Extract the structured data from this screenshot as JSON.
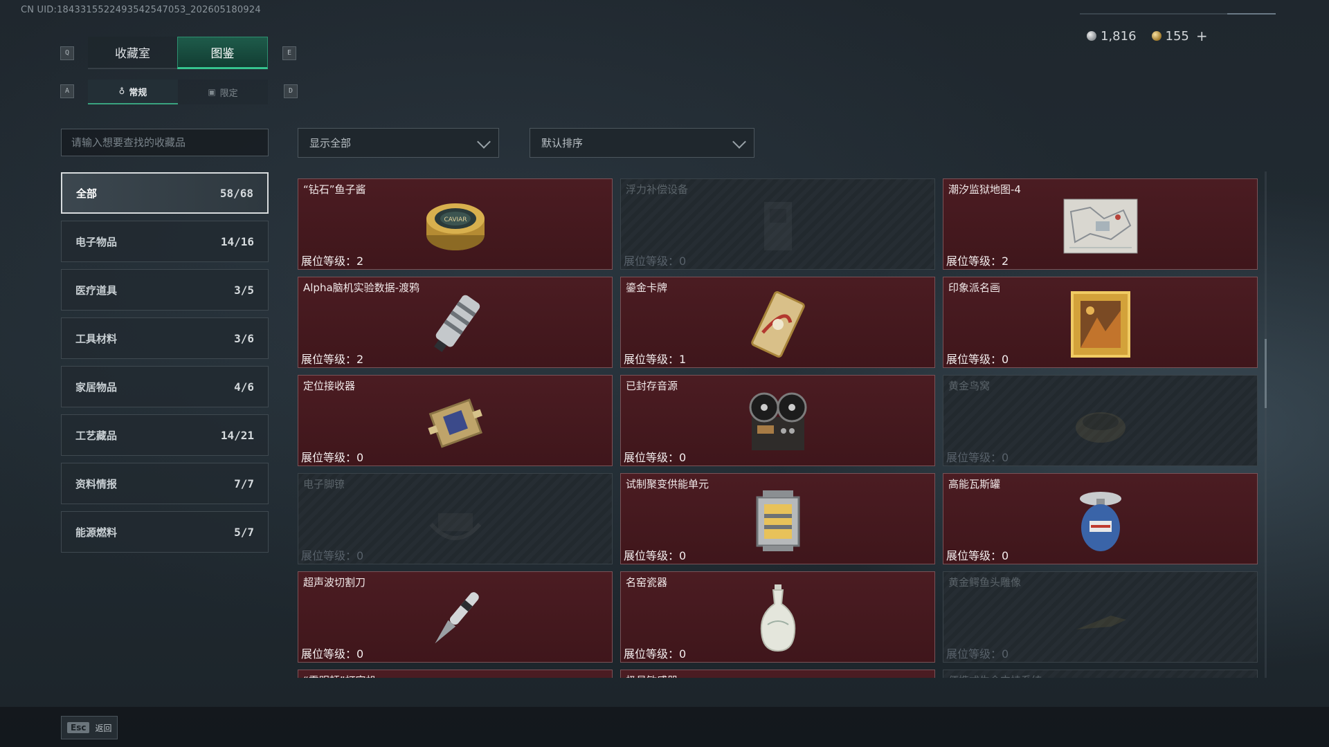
{
  "uid": "CN UID:1843315522493542547053_202605180924",
  "currency": {
    "silver": "1,816",
    "gold": "155",
    "add": "+"
  },
  "keys": {
    "prev_tab": "Q",
    "next_tab": "E",
    "prev_sub": "A",
    "next_sub": "D"
  },
  "tabs": [
    {
      "label": "收藏室"
    },
    {
      "label": "图鉴"
    }
  ],
  "subtabs": [
    {
      "label": "常规",
      "icon": "♁"
    },
    {
      "label": "限定",
      "icon": "▣"
    }
  ],
  "search": {
    "placeholder": "请输入想要查找的收藏品"
  },
  "filter": {
    "label": "显示全部"
  },
  "sort": {
    "label": "默认排序"
  },
  "categories": [
    {
      "name": "全部",
      "count": "58/68"
    },
    {
      "name": "电子物品",
      "count": "14/16"
    },
    {
      "name": "医疗道具",
      "count": "3/5"
    },
    {
      "name": "工具材料",
      "count": "3/6"
    },
    {
      "name": "家居物品",
      "count": "4/6"
    },
    {
      "name": "工艺藏品",
      "count": "14/21"
    },
    {
      "name": "资料情报",
      "count": "7/7"
    },
    {
      "name": "能源燃料",
      "count": "5/7"
    }
  ],
  "items": [
    {
      "name": "“钻石”鱼子酱",
      "level": "展位等级：2",
      "owned": true,
      "icon": "caviar-icon"
    },
    {
      "name": "浮力补偿设备",
      "level": "展位等级：0",
      "owned": false,
      "icon": "buoyancy-device-icon"
    },
    {
      "name": "潮汐监狱地图-4",
      "level": "展位等级：2",
      "owned": true,
      "icon": "map-icon"
    },
    {
      "name": "Alpha脑机实验数据-渡鸦",
      "level": "展位等级：2",
      "owned": true,
      "icon": "data-drive-icon"
    },
    {
      "name": "鎏金卡牌",
      "level": "展位等级：1",
      "owned": true,
      "icon": "gilded-card-icon"
    },
    {
      "name": "印象派名画",
      "level": "展位等级：0",
      "owned": true,
      "icon": "painting-icon"
    },
    {
      "name": "定位接收器",
      "level": "展位等级：0",
      "owned": true,
      "icon": "receiver-icon"
    },
    {
      "name": "已封存音源",
      "level": "展位等级：0",
      "owned": true,
      "icon": "tape-recorder-icon"
    },
    {
      "name": "黄金鸟窝",
      "level": "展位等级：0",
      "owned": false,
      "icon": "bird-nest-icon"
    },
    {
      "name": "电子脚镣",
      "level": "展位等级：0",
      "owned": false,
      "icon": "ankle-monitor-icon"
    },
    {
      "name": "试制聚变供能单元",
      "level": "展位等级：0",
      "owned": true,
      "icon": "fusion-cell-icon"
    },
    {
      "name": "高能瓦斯罐",
      "level": "展位等级：0",
      "owned": true,
      "icon": "gas-canister-icon"
    },
    {
      "name": "超声波切割刀",
      "level": "展位等级：0",
      "owned": true,
      "icon": "cutter-icon"
    },
    {
      "name": "名窑瓷器",
      "level": "展位等级：0",
      "owned": true,
      "icon": "porcelain-vase-icon"
    },
    {
      "name": "黄金鳄鱼头雕像",
      "level": "展位等级：0",
      "owned": false,
      "icon": "crocodile-statue-icon"
    },
    {
      "name": "“雷明顿”打字机",
      "level": "",
      "owned": true,
      "icon": "typewriter-icon"
    },
    {
      "name": "极易敏感器",
      "level": "",
      "owned": true,
      "icon": "sensor-icon"
    },
    {
      "name": "便携式生命支持系统",
      "level": "",
      "owned": false,
      "icon": "life-support-icon"
    }
  ],
  "footer": {
    "key": "Esc",
    "label": "返回"
  }
}
